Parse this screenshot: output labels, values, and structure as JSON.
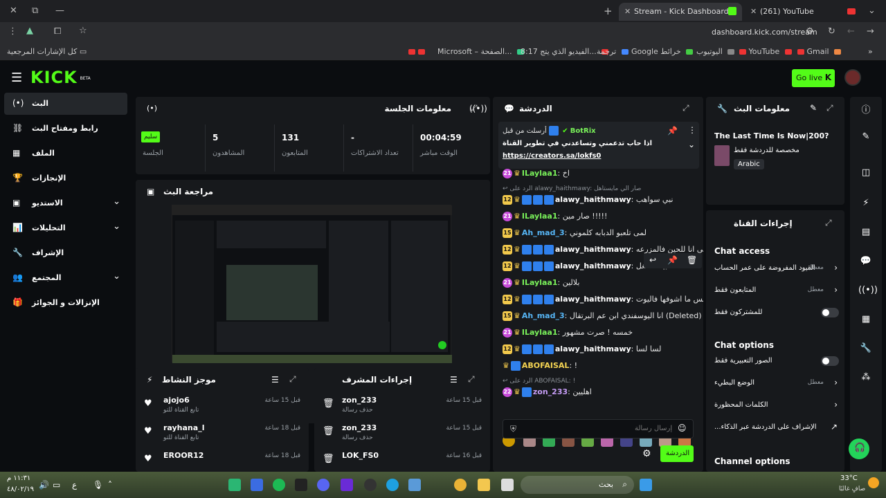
{
  "browser": {
    "tabs": [
      {
        "title": "Stream - Kick Dashboard",
        "active": true
      },
      {
        "title": "(261) YouTube",
        "active": false
      }
    ],
    "url": "dashboard.kick.com/stream",
    "bookmarks": {
      "all": "كل الإشارات المرجعية",
      "items": [
        "Microsoft – الصفحة...",
        "8:17 الفيديو الذي يتج...",
        "ترجمة",
        "Google خرائط",
        "اليوتيوب",
        "YouTube",
        "Gmail"
      ]
    }
  },
  "header": {
    "logo": "KICK",
    "logo_sup": "BETA",
    "go_live": "Go live"
  },
  "nav": [
    {
      "label": "البث",
      "icon": "(•)"
    },
    {
      "label": "رابط ومفتاح البث",
      "icon": "⛓"
    },
    {
      "label": "الملف",
      "icon": "▦"
    },
    {
      "label": "الإنجازات",
      "icon": "🏆"
    },
    {
      "label": "الاستديو",
      "icon": "▣"
    },
    {
      "label": "التحليلات",
      "icon": "📊"
    },
    {
      "label": "الإشراف",
      "icon": "🔧"
    },
    {
      "label": "المجتمع",
      "icon": "👥"
    },
    {
      "label": "الإنزالات و الجوائز",
      "icon": "🎁"
    }
  ],
  "session": {
    "title": "معلومات الجلسة",
    "status_badge": "سليم",
    "stats": [
      {
        "value": "00:04:59",
        "label": "الوقت مباشر"
      },
      {
        "value": "-",
        "label": "تعداد الاشتراكات"
      },
      {
        "value": "131",
        "label": "المتابعون"
      },
      {
        "value": "5",
        "label": "المشاهدون"
      },
      {
        "value": "",
        "label": "الجلسة"
      }
    ]
  },
  "review": {
    "title": "مراجعة البث"
  },
  "activity": {
    "title": "موجز النشاط",
    "items": [
      {
        "name": "ajojo6",
        "sub": "تابع القناة للتو",
        "time": "قبل 15 ساعة"
      },
      {
        "name": "rayhana_l",
        "sub": "تابع القناة للتو",
        "time": "قبل 18 ساعة"
      },
      {
        "name": "EROOR12",
        "sub": "",
        "time": "قبل 18 ساعة"
      }
    ]
  },
  "modactions": {
    "title": "إجراءات المشرف",
    "items": [
      {
        "name": "zon_233",
        "sub": "حذف رسالة",
        "time": "قبل 15 ساعة"
      },
      {
        "name": "zon_233",
        "sub": "حذف رسالة",
        "time": "قبل 15 ساعة"
      },
      {
        "name": "LOK_FS0",
        "sub": "",
        "time": "قبل 16 ساعة"
      }
    ]
  },
  "chat": {
    "title": "الدردشة",
    "pinned": {
      "top_name": "ILaylaa1",
      "sent_by": "أرسلت من قبل",
      "bot": "BotRix",
      "message": "اذا حاب تدعمني وتساعدني في تطوير القناة",
      "link": "https://creators.sa/lokfs0"
    },
    "messages": [
      {
        "badge": "21",
        "name": "ILaylaa1",
        "color": "n-green",
        "text": "اخ",
        "reply": ""
      },
      {
        "badge": "12",
        "name": "alawy_haithmawy",
        "color": "n-white",
        "text": "نبي سواهب",
        "reply": "الرد على alawy_haithmawy: صار الي مايستاهل"
      },
      {
        "badge": "21",
        "name": "ILaylaa1",
        "color": "n-green",
        "text": "صار مين !!!!!",
        "reply": ""
      },
      {
        "badge": "15",
        "name": "Ah_mad_3",
        "color": "n-blue",
        "text": "لمى تلعبو الدبابه كلموني",
        "reply": ""
      },
      {
        "badge": "12",
        "name": "alawy_haithmawy",
        "color": "n-white",
        "text": "ياخي انا للحين فالمزرعه",
        "reply": ""
      },
      {
        "badge": "12",
        "name": "alawy_haithmawy",
        "color": "n-white",
        "text": "حبيتك شغل",
        "reply": ""
      },
      {
        "badge": "21",
        "name": "ILaylaa1",
        "color": "n-green",
        "text": "بلالين",
        "reply": ""
      },
      {
        "badge": "12",
        "name": "alawy_haithmawy",
        "color": "n-white",
        "text": "بس ما اشوفها فاليوت",
        "reply": ""
      },
      {
        "badge": "15",
        "name": "Ah_mad_3",
        "color": "n-blue",
        "text": "انا اليوسفندي ابن عم البرتقال (Deleted)",
        "reply": ""
      },
      {
        "badge": "21",
        "name": "ILaylaa1",
        "color": "n-green",
        "text": "خمسه ! صرت مشهور",
        "reply": ""
      },
      {
        "badge": "12",
        "name": "alawy_haithmawy",
        "color": "n-white",
        "text": "لسا لسا",
        "reply": ""
      },
      {
        "badge": "",
        "name": "ABOFAISAL",
        "color": "n-yellow",
        "text": "!",
        "reply": ""
      },
      {
        "badge": "22",
        "name": "zon_233",
        "color": "n-purple",
        "text": "اهليين",
        "reply": "الرد على ABOFAISAL: !"
      }
    ],
    "input_placeholder": "إرسال رسالة",
    "send_button": "الدردشة"
  },
  "stream_info": {
    "title": "معلومات البث",
    "stream_title": "The Last Time Is Now|200?",
    "subtitle": "مخصصة للدردشة فقط",
    "language": "Arabic"
  },
  "channel_actions": {
    "title": "إجراءات القناة",
    "chat_access_heading": "Chat access",
    "chat_options_heading": "Chat options",
    "channel_options_heading": "Channel options",
    "access_items": [
      {
        "label": "القيود المفروضة على عمر الحساب",
        "value": "معطل",
        "kind": "chevron"
      },
      {
        "label": "المتابعون فقط",
        "value": "معطل",
        "kind": "chevron"
      },
      {
        "label": "للمشتركون فقط",
        "value": "",
        "kind": "toggle"
      }
    ],
    "option_items": [
      {
        "label": "الصور التعبيرية فقط",
        "value": "",
        "kind": "toggle"
      },
      {
        "label": "الوضع البطيء",
        "value": "معطل",
        "kind": "chevron"
      },
      {
        "label": "الكلمات المحظورة",
        "value": "",
        "kind": "chevron"
      },
      {
        "label": "الإشراف على الدردشة عبر الذكاء...",
        "value": "",
        "kind": "external"
      }
    ]
  },
  "taskbar": {
    "search": "بحث",
    "weather_temp": "33°C",
    "weather_desc": "صافٍ غالبًا",
    "time": "١١:٣١ م",
    "date": "٤٨/٠٢/١٩",
    "lang": "ع"
  },
  "colors": {
    "brand": "#53fc18",
    "panel": "#17191c",
    "background": "#0b0d10"
  }
}
